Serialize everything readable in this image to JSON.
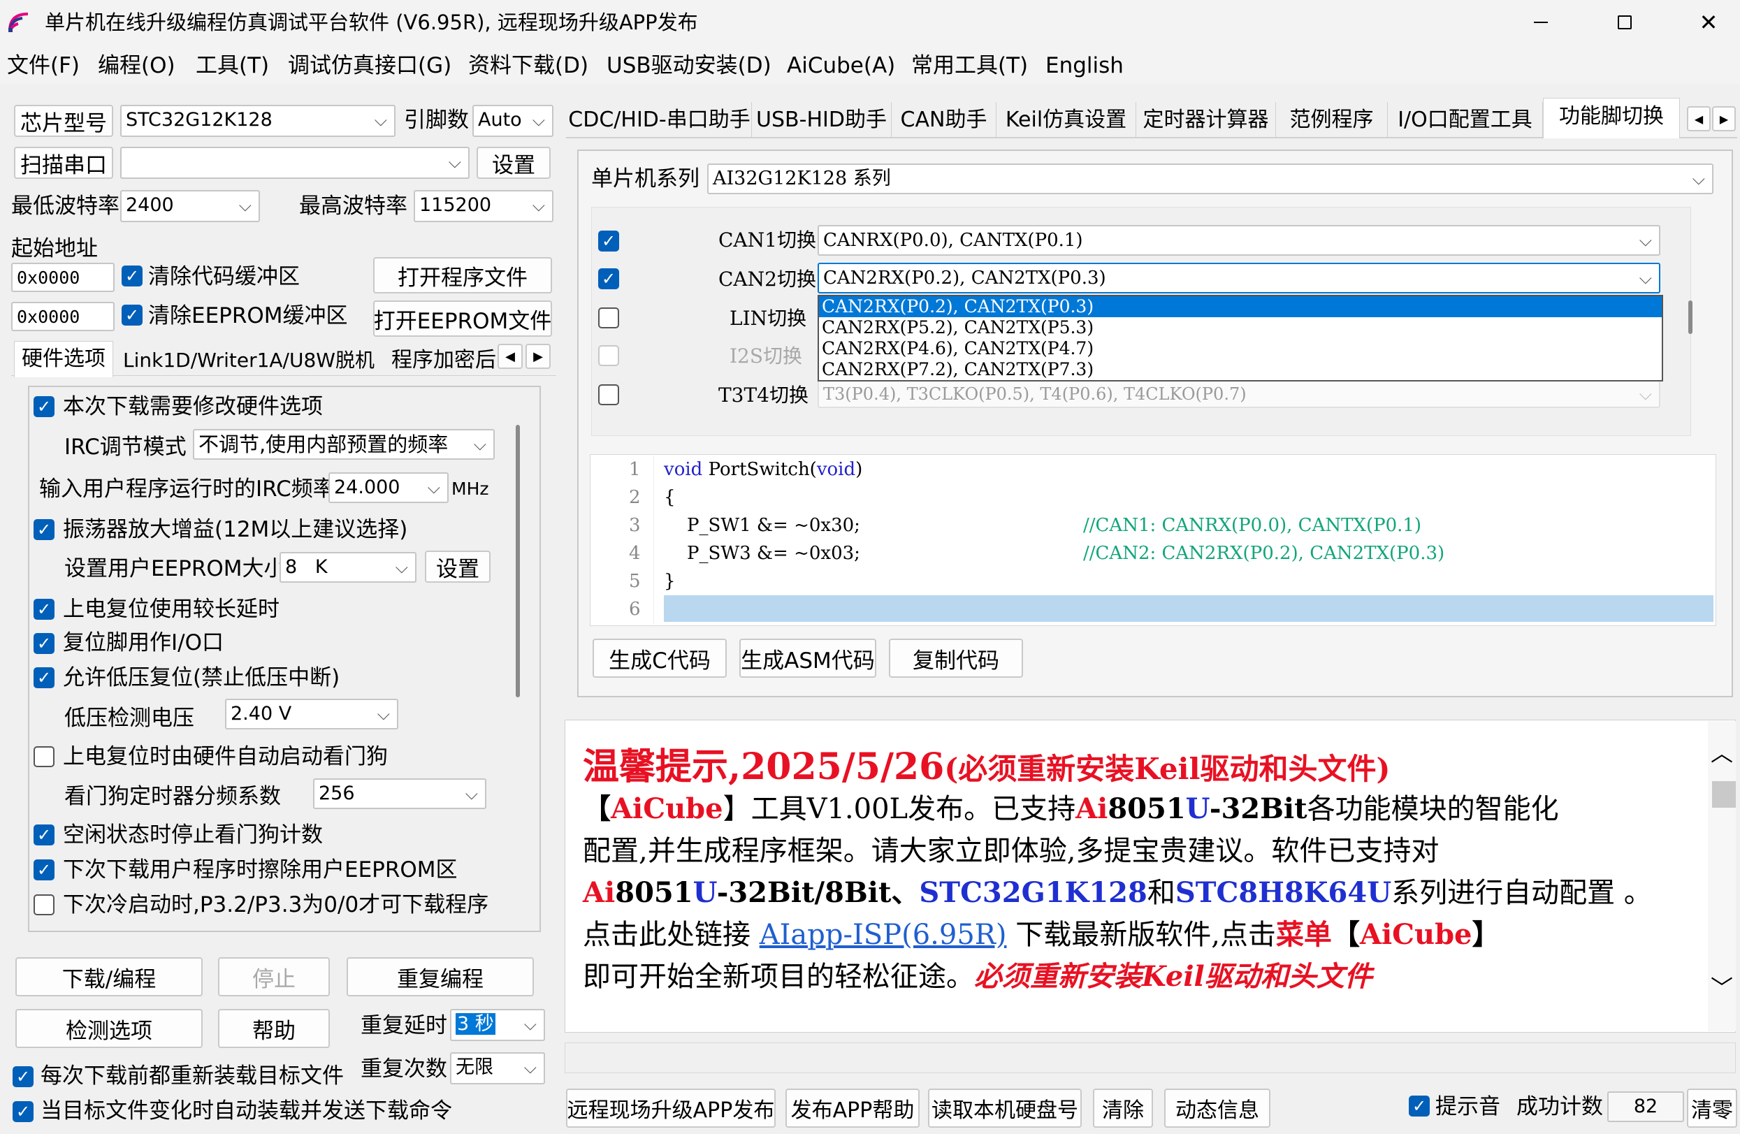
{
  "window": {
    "title": "单片机在线升级编程仿真调试平台软件 (V6.95R), 远程现场升级APP发布"
  },
  "menu": [
    "文件(F)",
    "编程(O)",
    "工具(T)",
    "调试仿真接口(G)",
    "资料下载(D)",
    "USB驱动安装(D)",
    "AiCube(A)",
    "常用工具(T)",
    "English"
  ],
  "left": {
    "chip_label": "芯片型号",
    "chip_value": "STC32G12K128",
    "pins_label": "引脚数",
    "pins_value": "Auto",
    "scan_label": "扫描串口",
    "port_value": "",
    "settings_label": "设置",
    "min_baud_label": "最低波特率",
    "min_baud_value": "2400",
    "max_baud_label": "最高波特率",
    "max_baud_value": "115200",
    "start_addr_label": "起始地址",
    "addr1": "0x0000",
    "clear_code_label": "清除代码缓冲区",
    "open_prog_label": "打开程序文件",
    "addr2": "0x0000",
    "clear_eeprom_label": "清除EEPROM缓冲区",
    "open_eeprom_label": "打开EEPROM文件",
    "tabs": [
      "硬件选项",
      "Link1D/Writer1A/U8W脱机",
      "程序加密后"
    ],
    "hw": {
      "modify_hw": "本次下载需要修改硬件选项",
      "irc_mode_label": "IRC调节模式",
      "irc_mode_value": "不调节,使用内部预置的频率",
      "irc_freq_label": "输入用户程序运行时的IRC频率",
      "irc_freq_value": "24.000",
      "irc_freq_unit": "MHz",
      "osc_gain": "振荡器放大增益(12M以上建议选择)",
      "eeprom_size_label": "设置用户EEPROM大小",
      "eeprom_size_value": "8   K",
      "eeprom_set_btn": "设置",
      "long_delay": "上电复位使用较长延时",
      "reset_io": "复位脚用作I/O口",
      "lv_reset": "允许低压复位(禁止低压中断)",
      "lv_voltage_label": "低压检测电压",
      "lv_voltage_value": "2.40 V",
      "wdt_auto": "上电复位时由硬件自动启动看门狗",
      "wdt_div_label": "看门狗定时器分频系数",
      "wdt_div_value": "256",
      "idle_wdt": "空闲状态时停止看门狗计数",
      "erase_eeprom": "下次下载用户程序时擦除用户EEPROM区",
      "cold_boot": "下次冷启动时,P3.2/P3.3为0/0才可下载程序"
    },
    "download_btn": "下载/编程",
    "stop_btn": "停止",
    "repeat_btn": "重复编程",
    "check_btn": "检测选项",
    "help_btn": "帮助",
    "repeat_delay_label": "重复延时",
    "repeat_delay_value": "3 秒",
    "repeat_count_label": "重复次数",
    "repeat_count_value": "无限",
    "reload_each": "每次下载前都重新装载目标文件",
    "auto_reload": "当目标文件变化时自动装载并发送下载命令"
  },
  "right": {
    "tabs": [
      "CDC/HID-串口助手",
      "USB-HID助手",
      "CAN助手",
      "Keil仿真设置",
      "定时器计算器",
      "范例程序",
      "I/O口配置工具",
      "功能脚切换"
    ],
    "series_label": "单片机系列",
    "series_value": "AI32G12K128 系列",
    "switches": [
      {
        "label": "CAN1切换",
        "value": "CANRX(P0.0), CANTX(P0.1)"
      },
      {
        "label": "CAN2切换",
        "value": "CAN2RX(P0.2), CAN2TX(P0.3)"
      },
      {
        "label": "LIN切换",
        "value": ""
      },
      {
        "label": "I2S切换",
        "value": ""
      },
      {
        "label": "T3T4切换",
        "value": "T3(P0.4), T3CLKO(P0.5), T4(P0.6), T4CLKO(P0.7)"
      }
    ],
    "dropdown_options": [
      "CAN2RX(P0.2), CAN2TX(P0.3)",
      "CAN2RX(P5.2), CAN2TX(P5.3)",
      "CAN2RX(P4.6), CAN2TX(P4.7)",
      "CAN2RX(P7.2), CAN2TX(P7.3)"
    ],
    "code": {
      "line_numbers": [
        "1",
        "2",
        "3",
        "4",
        "5",
        "6"
      ],
      "l1_kw1": "void",
      "l1_fn": " PortSwitch(",
      "l1_kw2": "void",
      "l1_end": ")",
      "l2": "{",
      "l3_code": "    P_SW1 &= ~0x30;",
      "l3_cm": "//CAN1: CANRX(P0.0), CANTX(P0.1)",
      "l4_code": "    P_SW3 &= ~0x03;",
      "l4_cm": "//CAN2: CAN2RX(P0.2), CAN2TX(P0.3)",
      "l5": "}"
    },
    "gen_c_btn": "生成C代码",
    "gen_asm_btn": "生成ASM代码",
    "copy_btn": "复制代码"
  },
  "notice": {
    "title_prefix": "温馨提示,",
    "date": "2025/5/26",
    "title_suffix": "(必须重新安装Keil驱动和头文件)",
    "p1a": "【",
    "p1b": "AiCube",
    "p1c": "】工具V1.00L发布。已支持",
    "p1d": "Ai",
    "p1e": "8051",
    "p1f": "U",
    "p1g": "-32Bit",
    "p1h": "各功能模块的智能化",
    "p2": "配置,并生成程序框架。请大家立即体验,多提宝贵建议。软件已支持对",
    "p3a": "Ai",
    "p3b": "8051",
    "p3c": "U",
    "p3d": "-32Bit/8Bit、",
    "p3e": "STC32G1K128",
    "p3f": "和",
    "p3g": "STC8H8K64U",
    "p3h": "系列进行自动配置 。",
    "p4a": "点击此处链接 ",
    "p4link": "AIapp-ISP(6.95R)",
    "p4b": " 下载最新版软件,点击",
    "p4c": "菜单",
    "p4d": "【",
    "p4e": "AiCube",
    "p4f": "】",
    "p5a": "即可开始全新项目的轻松征途。",
    "p5b": "必须重新安装Keil驱动和头文件"
  },
  "bottom": {
    "app_publish_btn": "远程现场升级APP发布",
    "app_help_btn": "发布APP帮助",
    "read_disk_btn": "读取本机硬盘号",
    "clear_btn": "清除",
    "dyn_info_btn": "动态信息",
    "sound_label": "提示音",
    "success_label": "成功计数",
    "success_value": "82",
    "clear_count_btn": "清零"
  },
  "colors": {
    "accent": "#005fb8",
    "selection": "#0078d7",
    "warning_red": "#e81123",
    "link_blue": "#1f2fd0",
    "comment_green": "#12a57a",
    "code_highlight": "#b9d7ef"
  }
}
